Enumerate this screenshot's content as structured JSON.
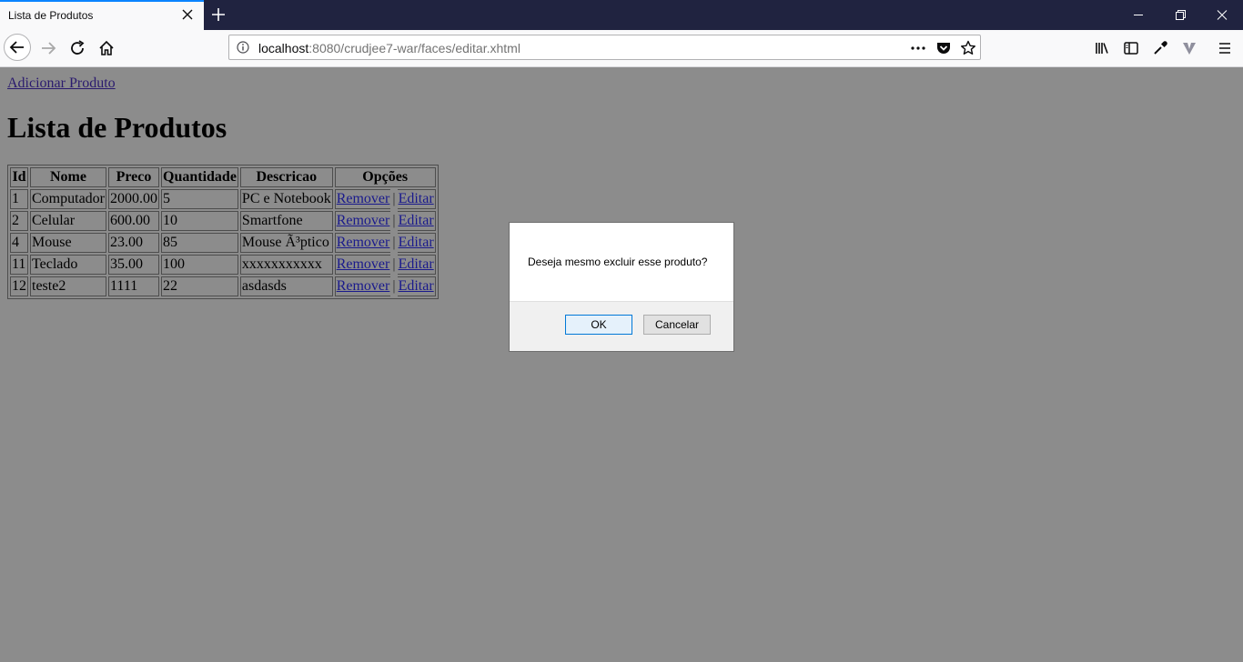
{
  "browser": {
    "tab_title": "Lista de Produtos",
    "url_host": "localhost",
    "url_rest": ":8080/crudjee7-war/faces/editar.xhtml",
    "url_more": "•••"
  },
  "page": {
    "add_link": "Adicionar Produto",
    "heading": "Lista de Produtos",
    "table": {
      "headers": [
        "Id",
        "Nome",
        "Preco",
        "Quantidade",
        "Descricao",
        "Opções"
      ],
      "rows": [
        {
          "id": "1",
          "nome": "Computador",
          "preco": "2000.00",
          "quantidade": "5",
          "descricao": "PC e Notebook"
        },
        {
          "id": "2",
          "nome": "Celular",
          "preco": "600.00",
          "quantidade": "10",
          "descricao": "Smartfone"
        },
        {
          "id": "4",
          "nome": "Mouse",
          "preco": "23.00",
          "quantidade": "85",
          "descricao": "Mouse Ã³ptico"
        },
        {
          "id": "11",
          "nome": "Teclado",
          "preco": "35.00",
          "quantidade": "100",
          "descricao": "xxxxxxxxxxx"
        },
        {
          "id": "12",
          "nome": "teste2",
          "preco": "1111",
          "quantidade": "22",
          "descricao": "asdasds"
        }
      ],
      "remove_label": "Remover",
      "separator": "|",
      "edit_label": "Editar"
    }
  },
  "dialog": {
    "message": "Deseja mesmo excluir esse produto?",
    "ok_label": "OK",
    "cancel_label": "Cancelar"
  }
}
